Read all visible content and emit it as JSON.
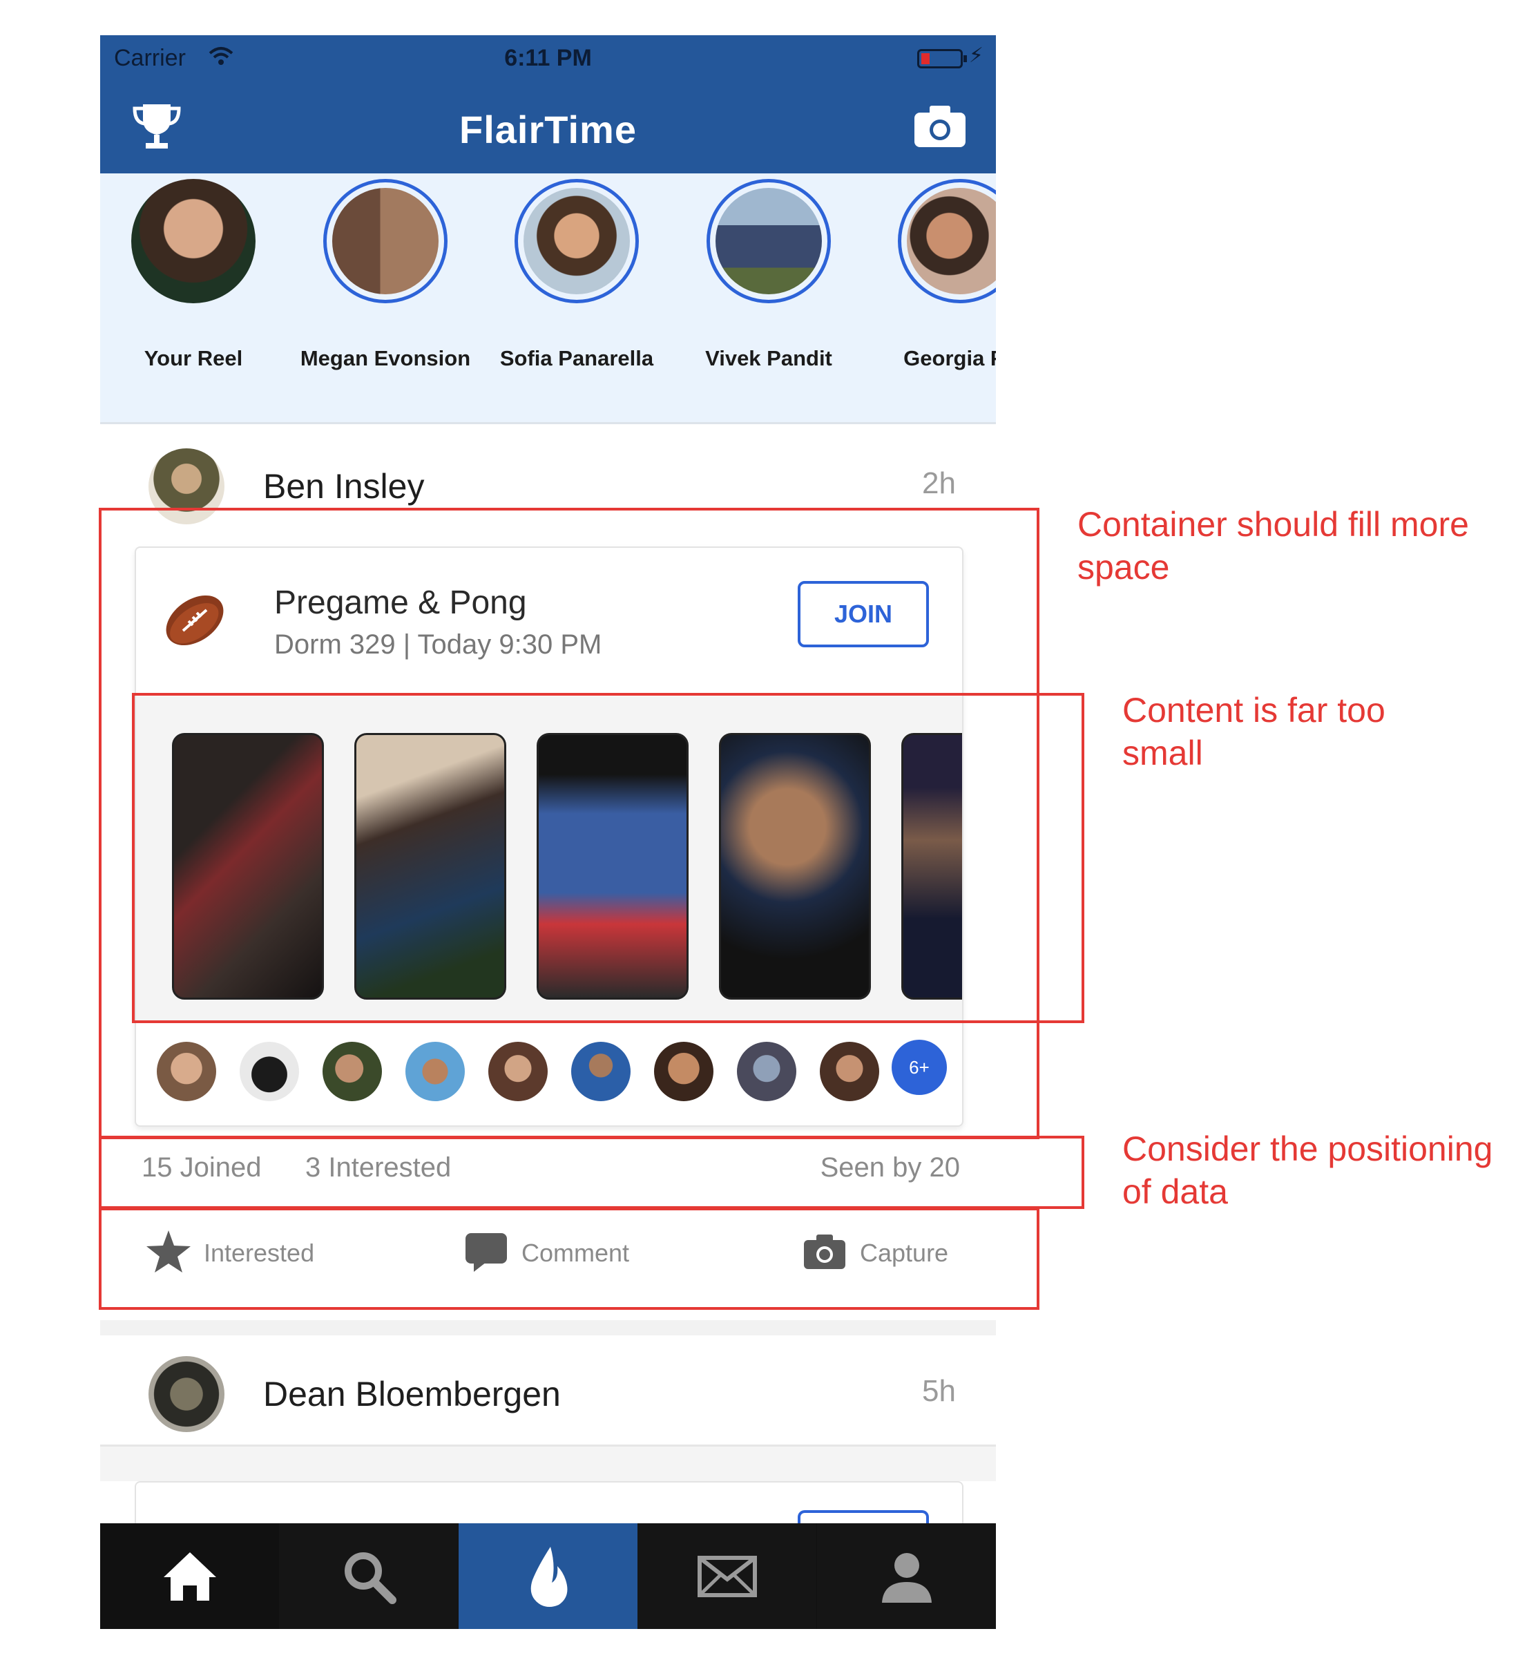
{
  "status_bar": {
    "carrier": "Carrier",
    "time": "6:11 PM"
  },
  "header": {
    "title": "FlairTime",
    "left_icon": "trophy-icon",
    "right_icon": "camera-icon",
    "brand_color": "#24579a"
  },
  "stories": [
    {
      "label": "Your Reel",
      "ring": false
    },
    {
      "label": "Megan Evonsion",
      "ring": true
    },
    {
      "label": "Sofia Panarella",
      "ring": true
    },
    {
      "label": "Vivek Pandit",
      "ring": true
    },
    {
      "label": "Georgia Fo",
      "ring": true
    }
  ],
  "posts": [
    {
      "author": "Ben Insley",
      "time_ago": "2h",
      "event": {
        "icon": "football-icon",
        "title": "Pregame & Pong",
        "subtitle": "Dorm 329 | Today 9:30 PM",
        "join_label": "JOIN",
        "more_label": "6+"
      },
      "stats": {
        "joined": "15 Joined",
        "interested": "3 Interested",
        "seen": "Seen by 20"
      },
      "actions": {
        "interested": "Interested",
        "comment": "Comment",
        "capture": "Capture"
      }
    },
    {
      "author": "Dean Bloembergen",
      "time_ago": "5h"
    }
  ],
  "tabbar": {
    "tabs": [
      "home-icon",
      "search-icon",
      "flame-icon",
      "mail-icon",
      "profile-icon"
    ],
    "active": "flame-icon"
  },
  "annotations": {
    "note1": "Container should fill more space",
    "note2": "Content is far too small",
    "note3": "Consider the positioning of data",
    "color": "#e53935"
  }
}
